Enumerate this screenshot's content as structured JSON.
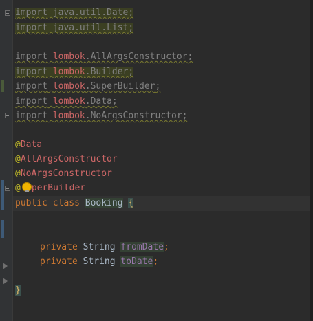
{
  "editor": {
    "imports": {
      "kw": "import",
      "util_date_path": "java.util.Date",
      "util_list_path": "java.util.List",
      "semi": ";",
      "lombok_pkg": "lombok",
      "lombok_all_args": ".AllArgsConstructor",
      "lombok_builder": ".Builder",
      "lombok_super_builder": ".SuperBuilder",
      "lombok_data": ".Data",
      "lombok_no_args": ".NoArgsConstructor"
    },
    "annotations": {
      "at": "@",
      "data": "Data",
      "all_args": "AllArgsConstructor",
      "no_args": "NoArgsConstructor",
      "super_builder_tail": "perBuilder"
    },
    "class_decl": {
      "modifiers": "public class",
      "name": "Booking",
      "open_brace": "{",
      "close_brace": "}"
    },
    "fields": {
      "modifier": "private",
      "type": "String",
      "field1": "fromDate",
      "field2": "toDate",
      "semi": ";"
    }
  },
  "colors": {
    "background": "#2b2b2b",
    "keyword": "#cc7832",
    "annotation": "#bbb529",
    "lombok_ref": "#cc6666",
    "field": "#9876aa",
    "brace": "#e8bf6a",
    "default_text": "#a9b7c6"
  },
  "icons": {
    "bulb": "intention-bulb-icon",
    "fold": "fold-marker-icon"
  }
}
